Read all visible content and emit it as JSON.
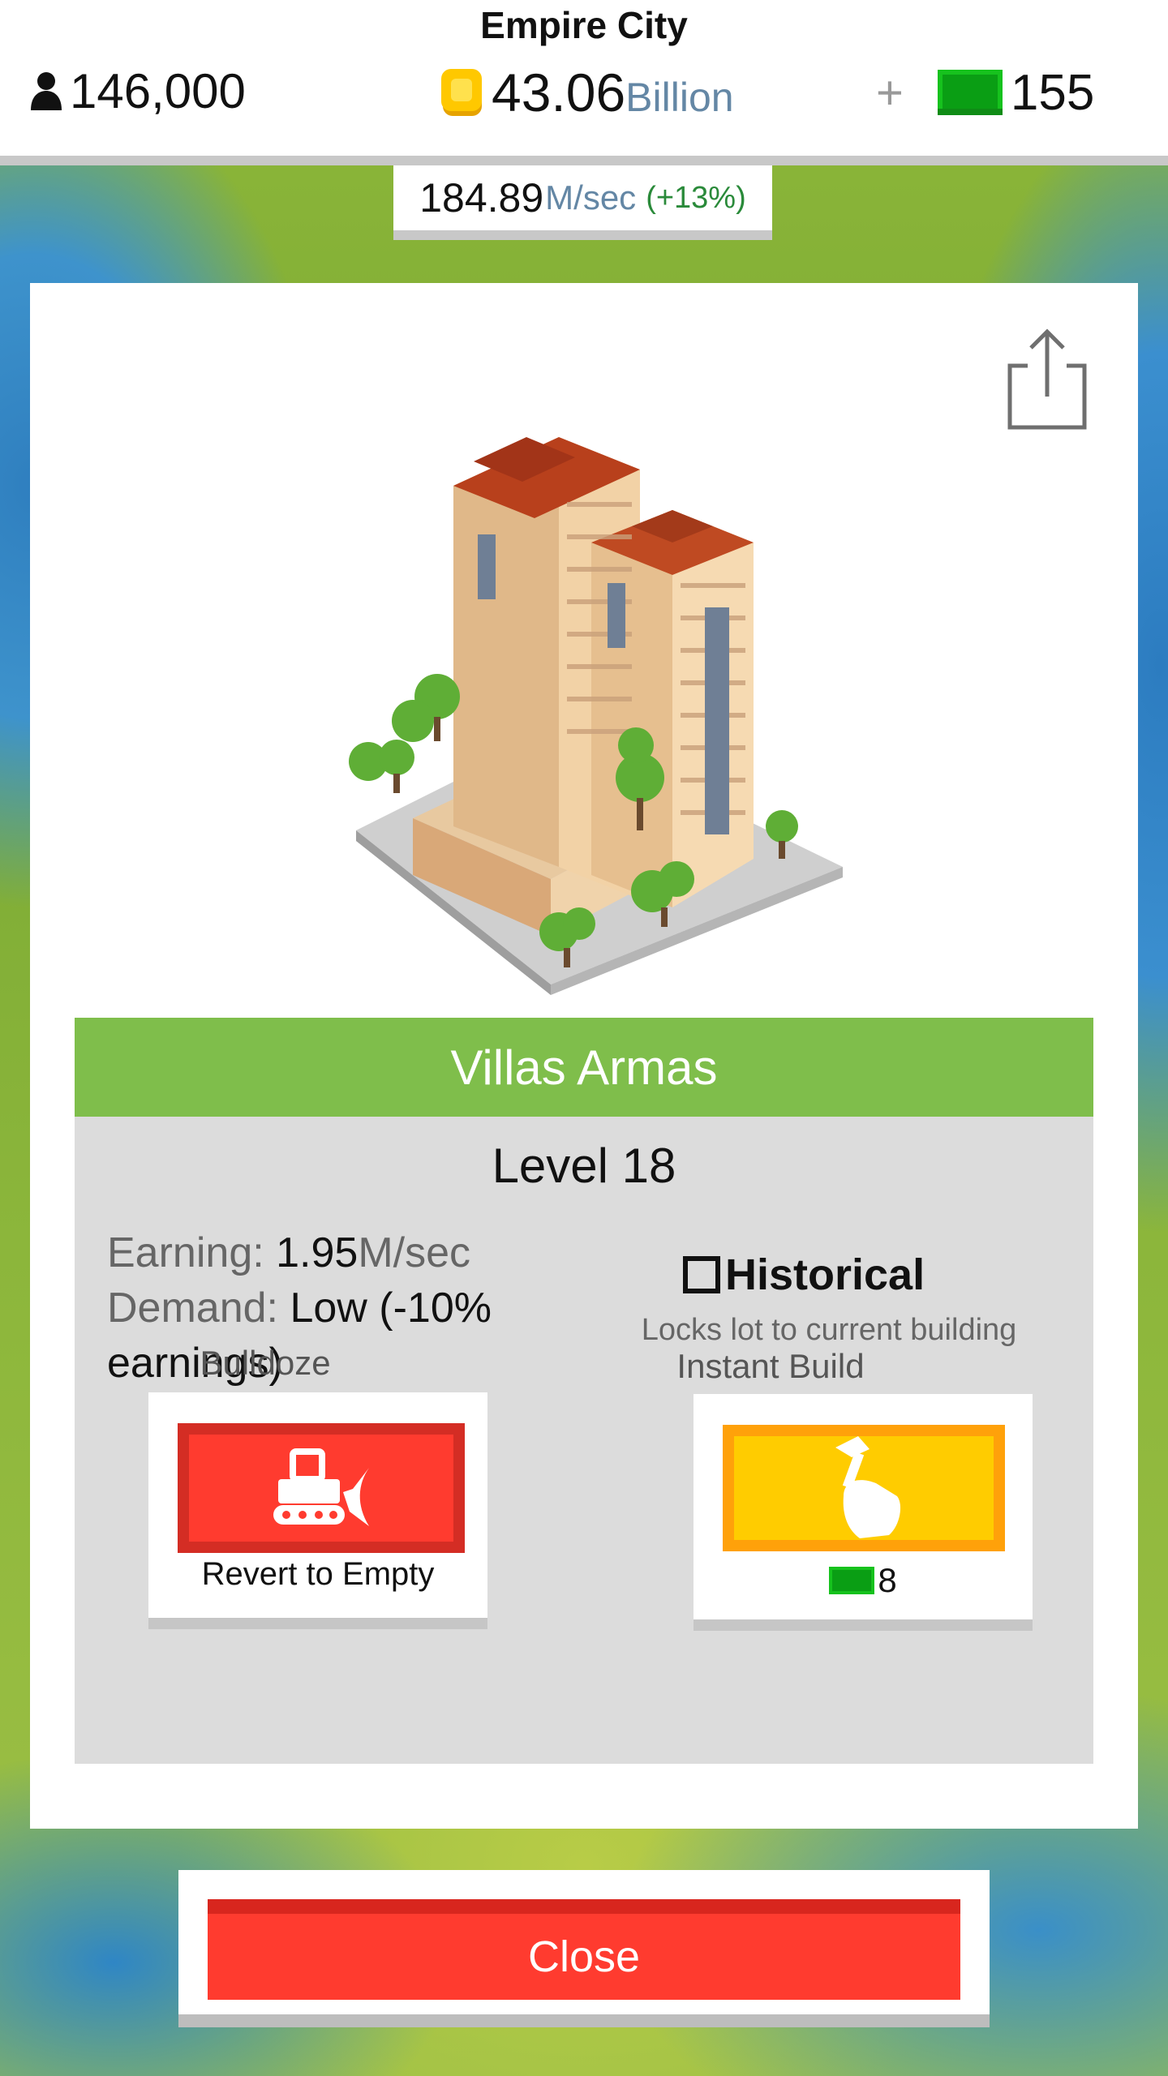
{
  "header": {
    "city_name": "Empire City",
    "population": "146,000",
    "coins_value": "43.06",
    "coins_unit": "Billion",
    "cash_add": "+",
    "cash_value": "155"
  },
  "income": {
    "value": "184.89",
    "unit": "M/sec",
    "bonus": "(+13%)"
  },
  "building": {
    "name": "Villas Armas",
    "level": "Level 18",
    "earning_label": "Earning:",
    "earning_value": "1.95",
    "earning_unit": "M/sec",
    "demand_label": "Demand:",
    "demand_value": "Low (-10% earnings)",
    "historical_checked": false,
    "historical_label": "Historical",
    "historical_desc": "Locks lot to current building"
  },
  "actions": {
    "bulldoze_title": "Bulldoze",
    "bulldoze_label": "Revert to Empty",
    "instant_build_title": "Instant Build",
    "instant_build_cost": "8"
  },
  "close_label": "Close",
  "icons": {
    "population": "person-icon",
    "coins": "coin-icon",
    "cash": "cash-bill-icon",
    "share": "share-icon",
    "bulldoze": "bulldozer-icon",
    "instant_build": "hammer-hand-icon"
  },
  "colors": {
    "name_bar": "#7fbe4b",
    "bulldoze_button": "#ff3b2f",
    "instant_build_button": "#ffcc00",
    "close_button": "#ff3b2f",
    "cash_green": "#16c21d",
    "unit_blue": "#6487a5"
  }
}
